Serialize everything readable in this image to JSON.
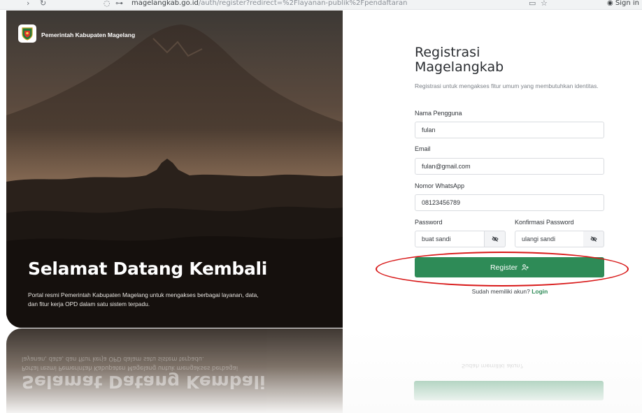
{
  "browser": {
    "url_host": "magelangkab.go.id",
    "url_path": "/auth/register?redirect=%2Flayanan-publik%2Fpendaftaran",
    "sign_in": "Sign in"
  },
  "hero": {
    "org_name": "Pemerintah Kabupaten Magelang",
    "welcome": "Selamat Datang Kembali",
    "description": "Portal resmi Pemerintah Kabupaten Magelang untuk mengakses berbagai layanan, data, dan fitur kerja OPD dalam satu sistem terpadu."
  },
  "form": {
    "title": "Registrasi Magelangkab",
    "subtitle": "Registrasi untuk mengakses fitur umum yang membutuhkan identitas.",
    "username": {
      "label": "Nama Pengguna",
      "value": "fulan"
    },
    "email": {
      "label": "Email",
      "value": "fulan@gmail.com"
    },
    "whatsapp": {
      "label": "Nomor WhatsApp",
      "value": "08123456789"
    },
    "password": {
      "label": "Password",
      "placeholder": "buat sandi"
    },
    "confirm_password": {
      "label": "Konfirmasi Password",
      "placeholder": "ulangi sandi"
    },
    "register_label": "Register",
    "login_prompt": "Sudah memiliki akun?",
    "login_link": "Login"
  },
  "colors": {
    "primary_green": "#2e8b57",
    "annotation_red": "#d81818"
  }
}
